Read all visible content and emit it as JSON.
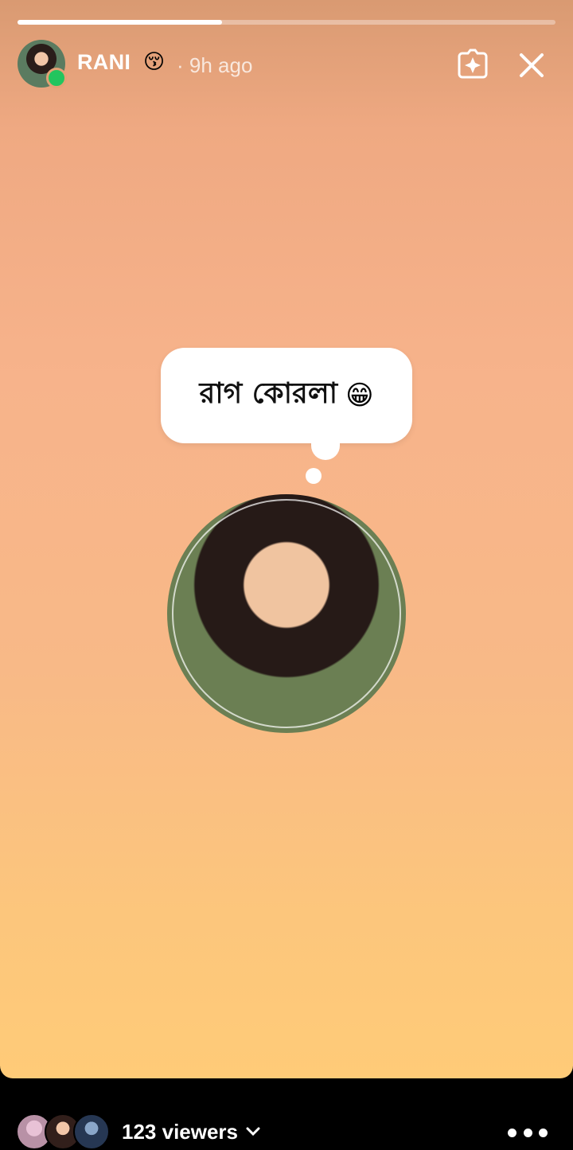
{
  "story": {
    "progress_fraction": 0.38,
    "user": {
      "name": "RANI",
      "emoji": "😚",
      "timestamp": "· 9h ago"
    },
    "icons": {
      "effect": "sparkle-icon",
      "close": "close-icon"
    },
    "sticker": {
      "text": "রাগ কোরলা",
      "emoji": "😁"
    }
  },
  "footer": {
    "viewers_label": "123 viewers",
    "icons": {
      "dropdown": "chevron-down-icon",
      "more": "more-options-icon"
    }
  },
  "colors": {
    "background_top": "#d99a72",
    "background_bottom": "#ffcb78",
    "online": "#22c55e"
  }
}
